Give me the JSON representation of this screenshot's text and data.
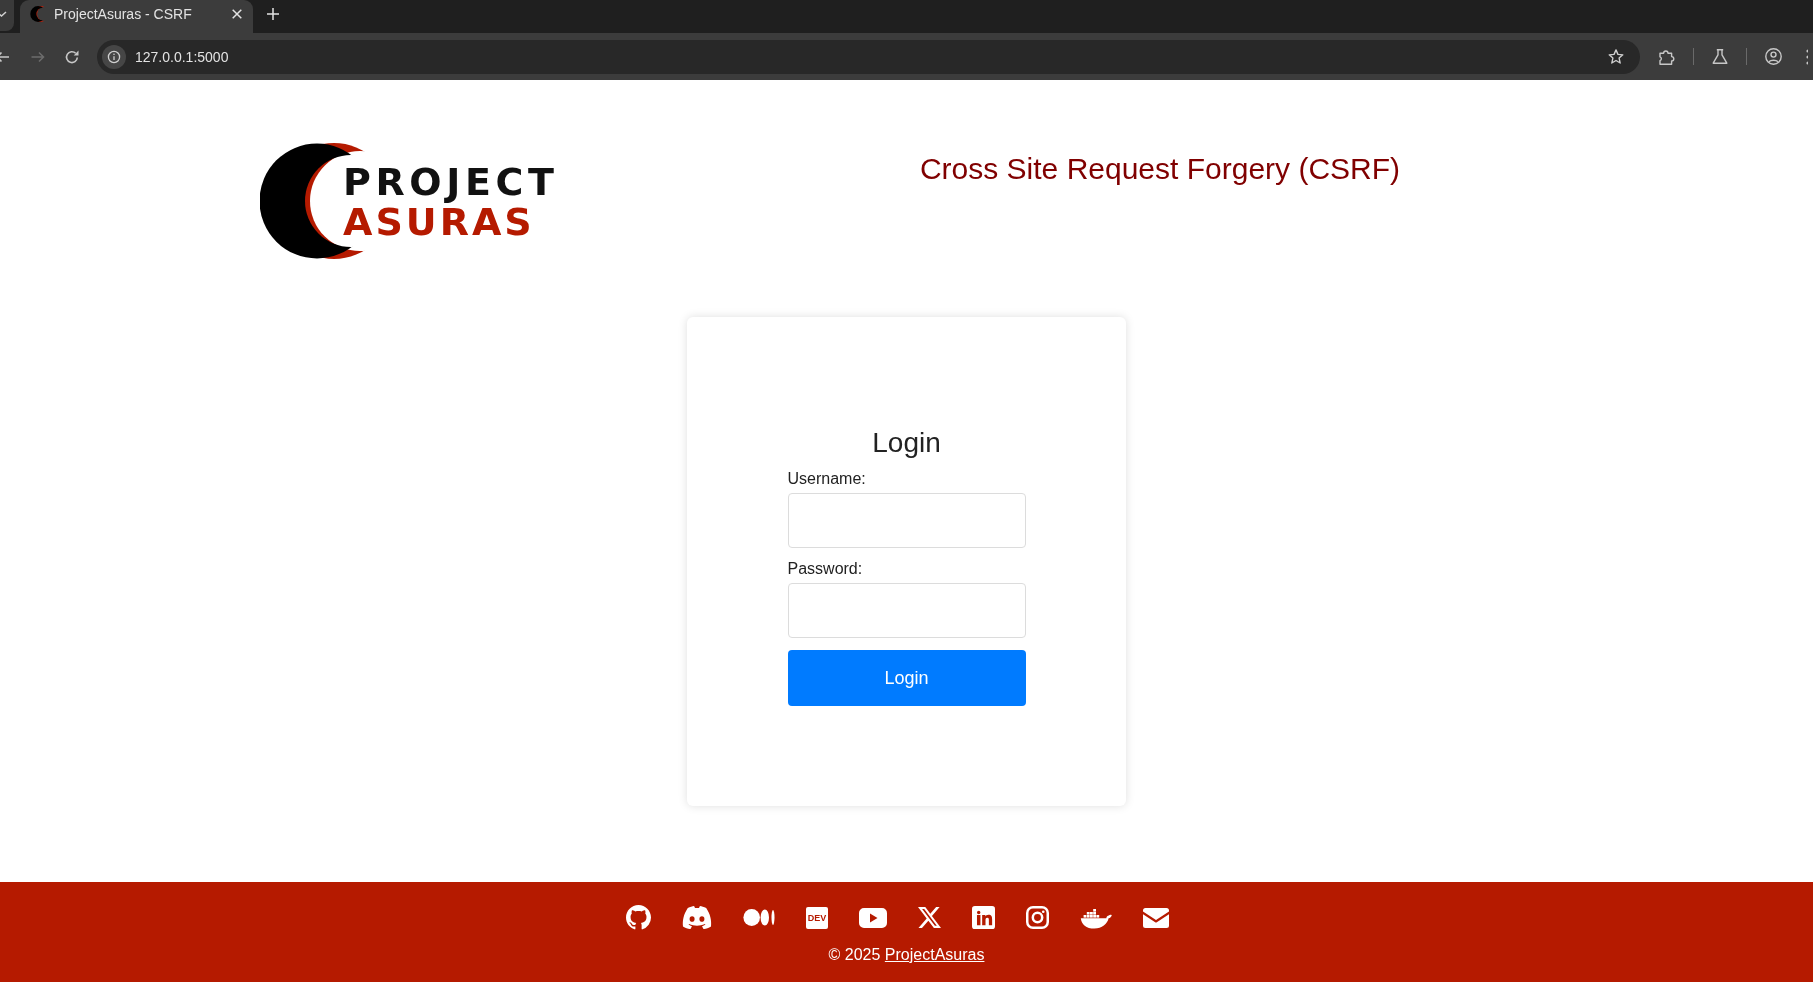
{
  "browser": {
    "tabs": [
      {
        "title": "ProjectAsuras - CSRF",
        "selected": true
      }
    ],
    "back": {
      "disabled": false
    },
    "forward": {
      "disabled": true
    },
    "address": "127.0.0.1:5000"
  },
  "header": {
    "logo": {
      "line_1": "PROJECT",
      "line_2": "ASURAS"
    },
    "title": "Cross Site Request Forgery (CSRF)"
  },
  "login_form": {
    "heading": "Login",
    "fields": [
      {
        "label": "Username:"
      },
      {
        "label": "Password:"
      }
    ],
    "submit": "Login"
  },
  "footer": {
    "dev_badge": "DEV",
    "copyright": "© 2025",
    "link": "ProjectAsuras"
  }
}
